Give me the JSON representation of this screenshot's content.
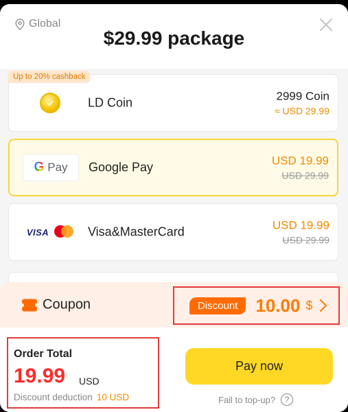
{
  "header": {
    "region": "Global",
    "title": "$29.99 package"
  },
  "payment_methods": [
    {
      "name": "LD Coin",
      "icon": "coin-icon",
      "tag": "Up to 20% cashback",
      "price_main": "2999 Coin",
      "price_sub": "≈ USD 29.99",
      "selected": false
    },
    {
      "name": "Google Pay",
      "icon": "google-pay-logo",
      "logo_text": "Pay",
      "price_main": "USD 19.99",
      "price_sub": "USD 29.99",
      "selected": true
    },
    {
      "name": "Visa&MasterCard",
      "icon": "visa-mastercard-logo",
      "logo_text": "VISA",
      "price_main": "USD 19.99",
      "price_sub": "USD 29.99",
      "selected": false
    }
  ],
  "coupon": {
    "label": "Coupon",
    "badge": "Discount",
    "amount": "10.00",
    "currency": "$"
  },
  "order": {
    "label": "Order Total",
    "amount": "19.99",
    "currency": "USD",
    "deduction_label": "Discount deduction",
    "deduction_value": "10 USD"
  },
  "actions": {
    "pay_label": "Pay now",
    "fail_label": "Fail to top-up?",
    "help_glyph": "?"
  },
  "colors": {
    "accent_yellow": "#ffd826",
    "accent_orange": "#ff7a00",
    "total_red": "#ff2b2b",
    "highlight_border": "#e23b3b"
  }
}
